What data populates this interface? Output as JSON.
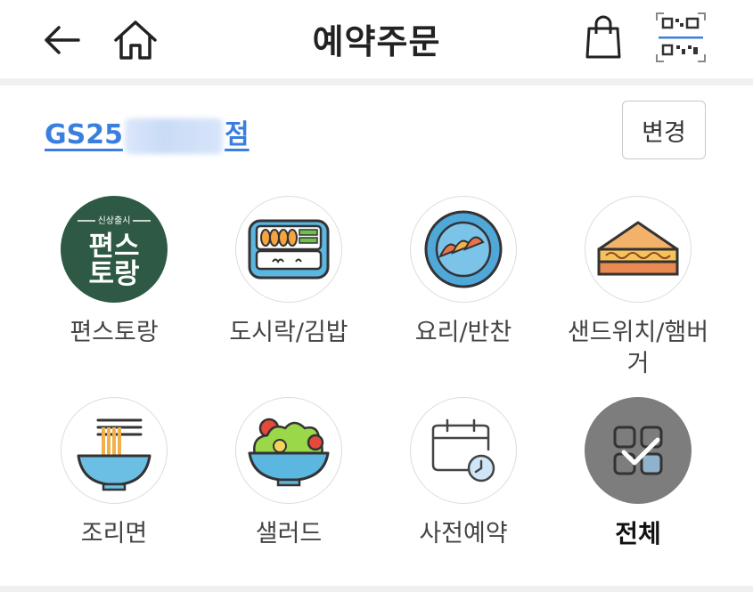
{
  "header": {
    "title": "예약주문",
    "back_icon": "back-arrow-icon",
    "home_icon": "home-icon",
    "bag_icon": "shopping-bag-icon",
    "qr_icon": "qr-code-icon"
  },
  "store": {
    "name_prefix": "GS25",
    "name_suffix": "점",
    "change_label": "변경"
  },
  "logo_text": {
    "top": "신상출시",
    "line1": "편스",
    "line2": "토랑"
  },
  "categories": [
    {
      "label": "편스토랑",
      "icon": "pyeonstorang-logo-icon"
    },
    {
      "label": "도시락/김밥",
      "icon": "lunchbox-icon"
    },
    {
      "label": "요리/반찬",
      "icon": "dish-icon"
    },
    {
      "label": "샌드위치/햄버거",
      "icon": "sandwich-icon"
    },
    {
      "label": "조리면",
      "icon": "noodle-bowl-icon"
    },
    {
      "label": "샐러드",
      "icon": "salad-bowl-icon"
    },
    {
      "label": "사전예약",
      "icon": "calendar-clock-icon"
    },
    {
      "label": "전체",
      "icon": "all-grid-icon"
    }
  ],
  "colors": {
    "store_link": "#3a7fe0",
    "logo_bg": "#2e5a45",
    "all_bg": "#7d7d7d"
  }
}
